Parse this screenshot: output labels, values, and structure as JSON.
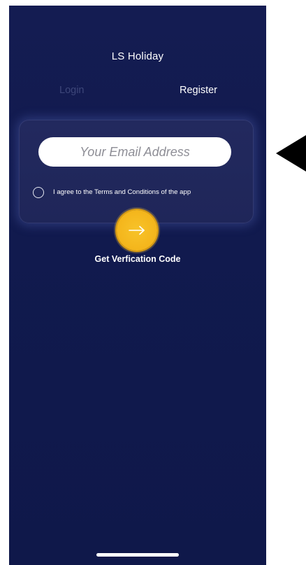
{
  "app": {
    "title": "LS Holiday"
  },
  "tabs": {
    "login_label": "Login",
    "register_label": "Register",
    "active": "Register"
  },
  "form": {
    "email_placeholder": "Your Email Address",
    "email_value": "",
    "agree_label": "I agree to the Terms and Conditions of the app",
    "agree_checked": false,
    "submit_icon": "arrow-right-icon",
    "cta_label": "Get Verfication Code"
  },
  "colors": {
    "background": "#121a4e",
    "card": "#21285c",
    "accent": "#f4b41a",
    "inactive_tab": "#3d4679",
    "text": "#ffffff"
  }
}
